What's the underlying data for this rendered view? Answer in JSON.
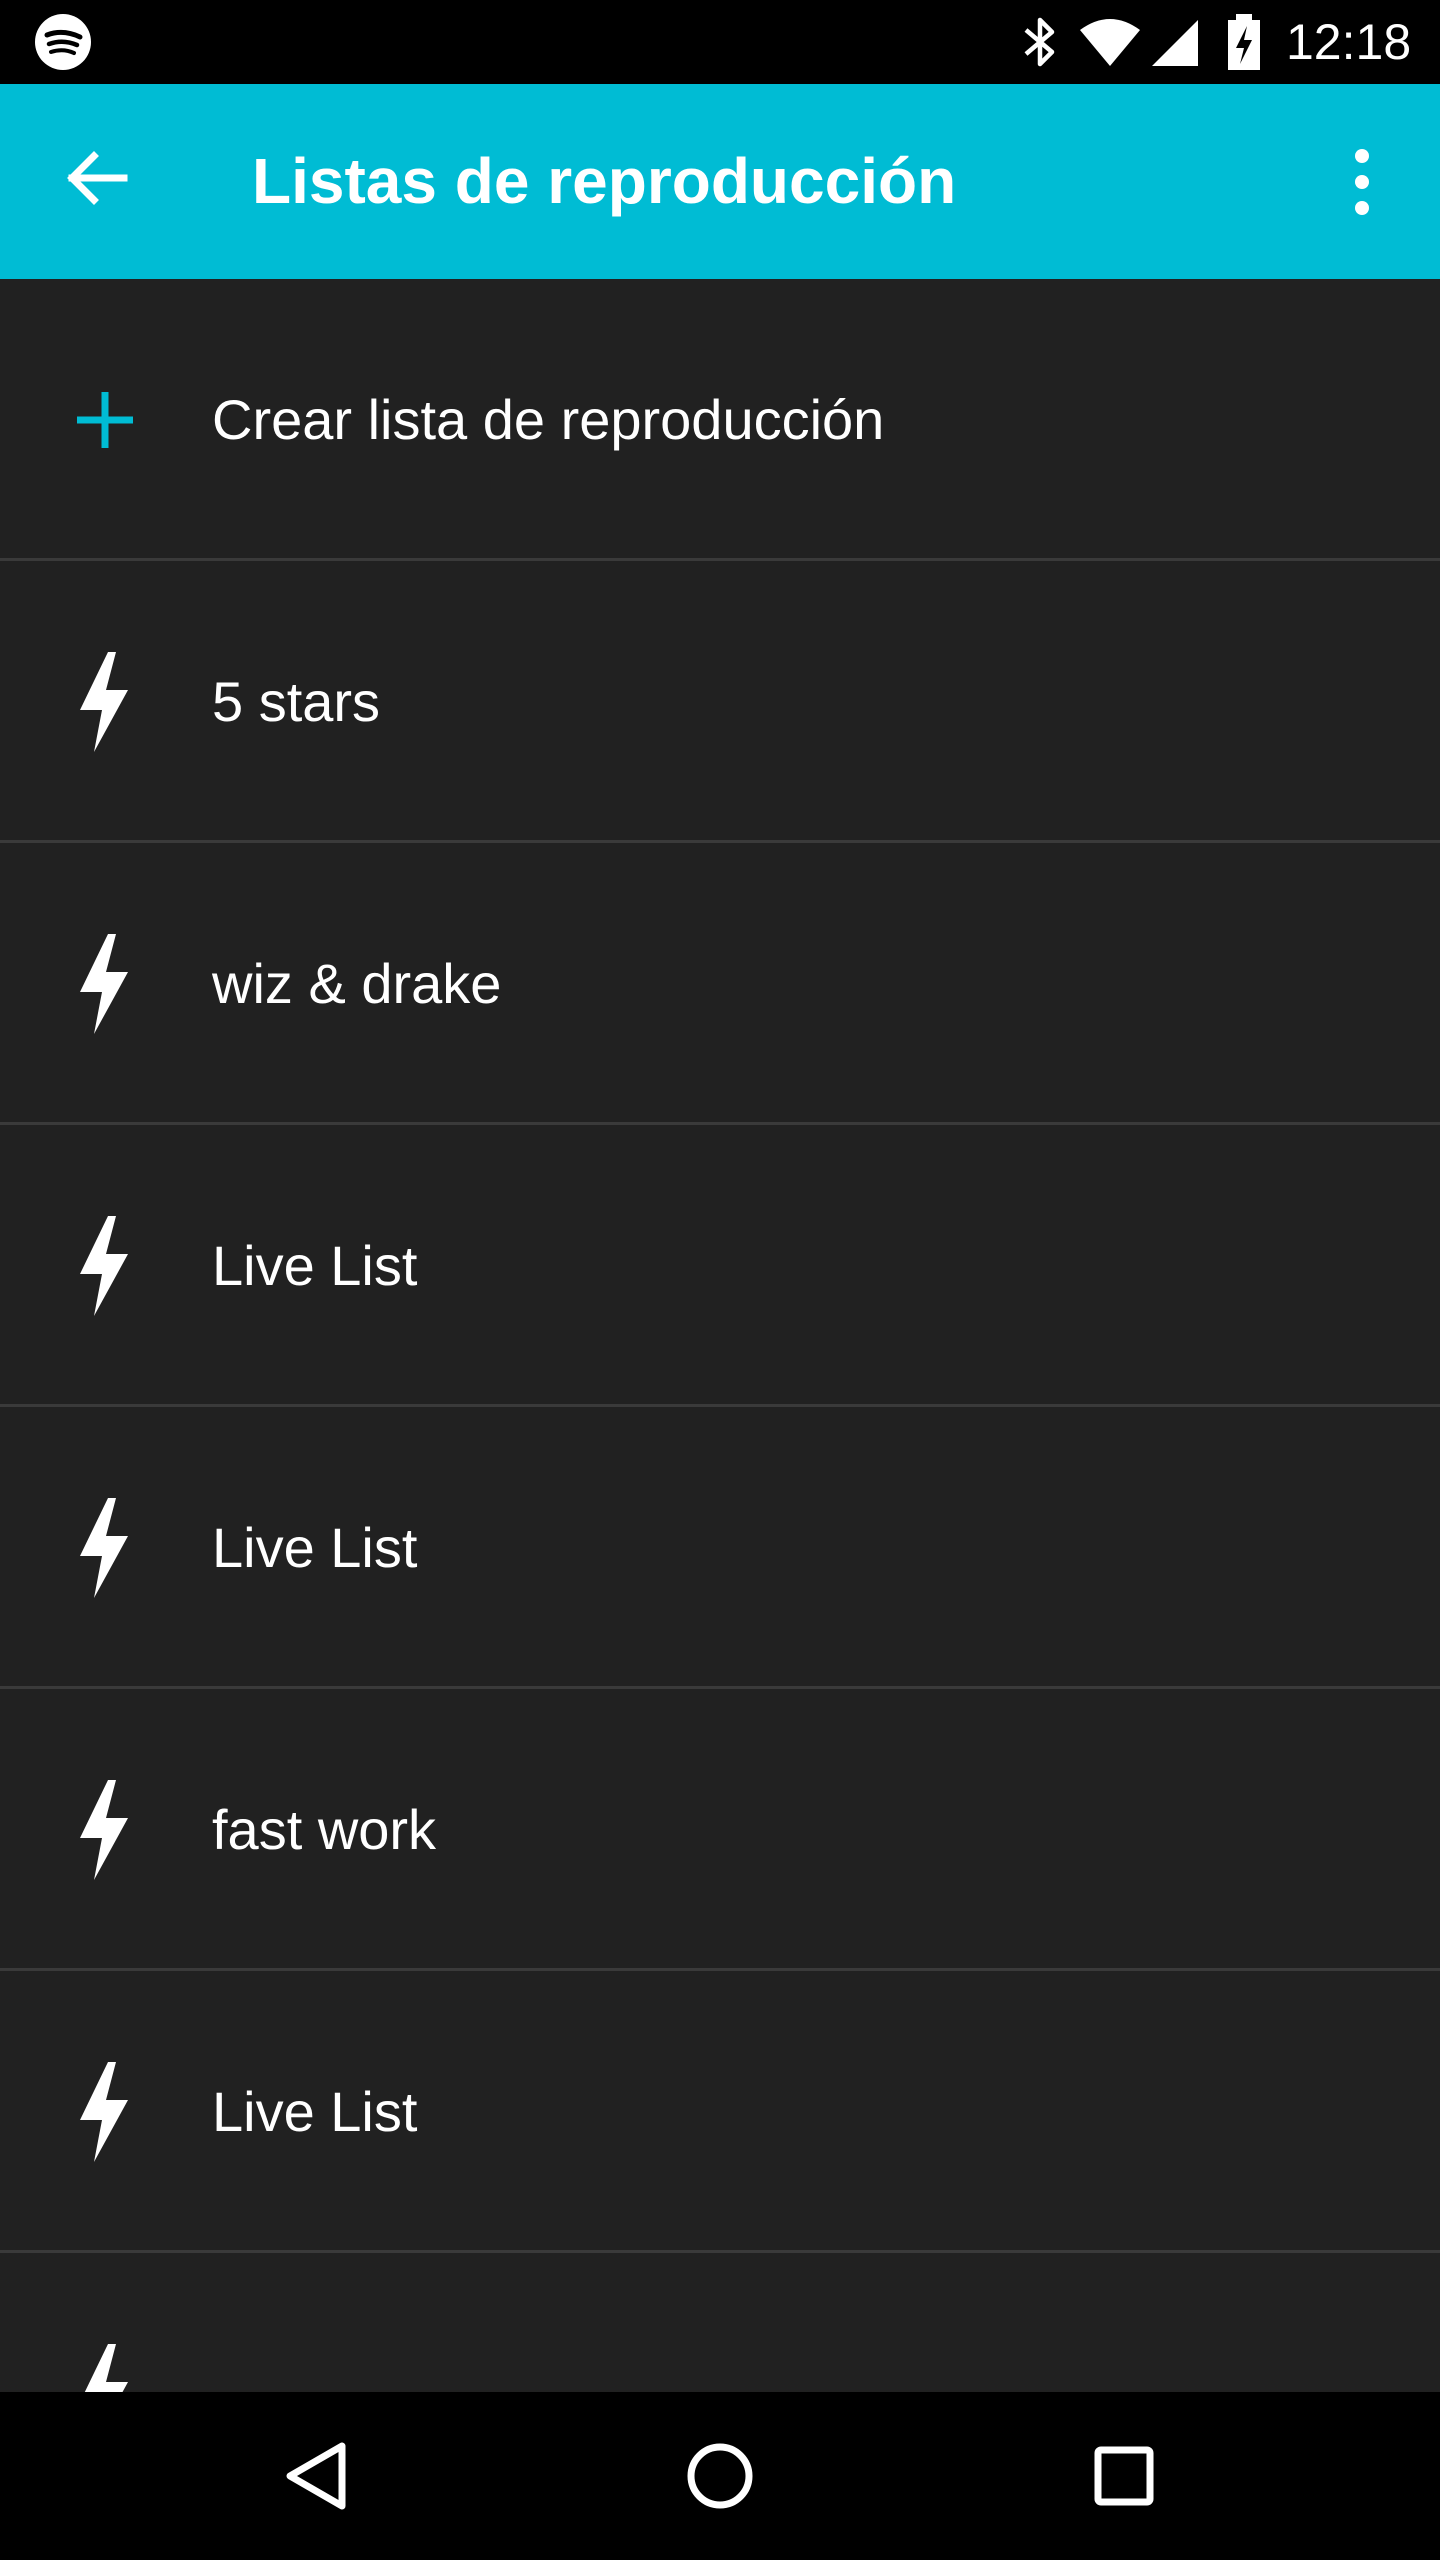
{
  "status_bar": {
    "time": "12:18",
    "icons": [
      "spotify-icon",
      "bluetooth-icon",
      "wifi-icon",
      "cell-signal-icon",
      "battery-charging-icon"
    ]
  },
  "app_bar": {
    "title": "Listas de reproducción",
    "color": "#00BCD4",
    "back_icon": "arrow-back-icon",
    "menu_icon": "more-vert-icon"
  },
  "list": {
    "create_label": "Crear lista de reproducción",
    "create_icon": "plus-icon",
    "accent_color": "#00BCD4",
    "playlists": [
      {
        "label": "5 stars",
        "icon": "lightning-bolt-icon"
      },
      {
        "label": "wiz & drake",
        "icon": "lightning-bolt-icon"
      },
      {
        "label": "Live List",
        "icon": "lightning-bolt-icon"
      },
      {
        "label": "Live List",
        "icon": "lightning-bolt-icon"
      },
      {
        "label": "fast work",
        "icon": "lightning-bolt-icon"
      },
      {
        "label": "Live List",
        "icon": "lightning-bolt-icon"
      }
    ]
  },
  "nav_bar": {
    "icons": [
      "nav-back-icon",
      "nav-home-icon",
      "nav-recents-icon"
    ]
  }
}
